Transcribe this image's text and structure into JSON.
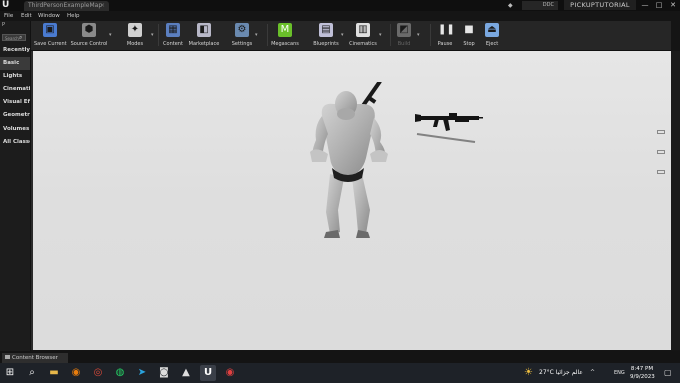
{
  "titlebar": {
    "logo": "U",
    "map_tab": "ThirdPersonExampleMap",
    "tab_close": "×",
    "ddc_label": "DDC",
    "project_name": "PICKUPTUTORIAL",
    "controls": [
      "—",
      "□",
      "✕"
    ]
  },
  "menu": [
    "File",
    "Edit",
    "Window",
    "Help"
  ],
  "modes_panel": {
    "mode_label": "P",
    "search_placeholder": "Search",
    "items": [
      {
        "label": "Recently",
        "selected": false
      },
      {
        "label": "Basic",
        "selected": true
      },
      {
        "label": "Lights",
        "selected": false
      },
      {
        "label": "Cinematic",
        "selected": false
      },
      {
        "label": "Visual Eff",
        "selected": false
      },
      {
        "label": "Geometry",
        "selected": false
      },
      {
        "label": "Volumes",
        "selected": false
      },
      {
        "label": "All Classe",
        "selected": false
      }
    ]
  },
  "toolbar": {
    "buttons": [
      {
        "label": "Save Current",
        "icon": "save-icon",
        "color": "#4a7bd0",
        "has_dropdown": false,
        "enabled": true
      },
      {
        "label": "Source Control",
        "icon": "source-control-icon",
        "color": "#8a8a8a",
        "has_dropdown": true,
        "enabled": true
      },
      {
        "label": "Modes",
        "icon": "modes-icon",
        "color": "#d0d0d0",
        "has_dropdown": true,
        "enabled": true
      },
      {
        "label": "Content",
        "icon": "content-icon",
        "color": "#5b7fc0",
        "has_dropdown": false,
        "enabled": true
      },
      {
        "label": "Marketplace",
        "icon": "marketplace-icon",
        "color": "#b8b8c8",
        "has_dropdown": false,
        "enabled": true
      },
      {
        "label": "Settings",
        "icon": "settings-icon",
        "color": "#6a8ab0",
        "has_dropdown": true,
        "enabled": true
      },
      {
        "label": "Megascans",
        "icon": "megascans-icon",
        "color": "#6ac02a",
        "has_dropdown": false,
        "enabled": true
      },
      {
        "label": "Blueprints",
        "icon": "blueprints-icon",
        "color": "#c0c0d8",
        "has_dropdown": true,
        "enabled": true
      },
      {
        "label": "Cinematics",
        "icon": "cinematics-icon",
        "color": "#e0e0e0",
        "has_dropdown": true,
        "enabled": true
      },
      {
        "label": "Build",
        "icon": "build-icon",
        "color": "#6a6a6a",
        "has_dropdown": true,
        "enabled": false
      },
      {
        "label": "Pause",
        "icon": "pause-icon",
        "color": "#e6e6e6",
        "has_dropdown": false,
        "enabled": true
      },
      {
        "label": "Stop",
        "icon": "stop-icon",
        "color": "#e6e6e6",
        "has_dropdown": false,
        "enabled": true
      },
      {
        "label": "Eject",
        "icon": "eject-icon",
        "color": "#7aa8e0",
        "has_dropdown": false,
        "enabled": true
      }
    ]
  },
  "viewport": {
    "character": "mannequin-with-rifle",
    "pickup": "rifle-pickup"
  },
  "content_browser": {
    "tab_label": "Content Browser"
  },
  "taskbar": {
    "apps": [
      {
        "name": "windows-start-icon",
        "glyph": "⊞",
        "color": "#ffffff"
      },
      {
        "name": "search-icon",
        "glyph": "⌕",
        "color": "#ffffff"
      },
      {
        "name": "file-explorer-icon",
        "glyph": "▬",
        "color": "#e8b84a"
      },
      {
        "name": "blender-icon",
        "glyph": "◉",
        "color": "#e87d0d"
      },
      {
        "name": "chrome-icon",
        "glyph": "◎",
        "color": "#e04b3a"
      },
      {
        "name": "whatsapp-icon",
        "glyph": "◍",
        "color": "#25d366"
      },
      {
        "name": "telegram-icon",
        "glyph": "➤",
        "color": "#2aa3de"
      },
      {
        "name": "obs-icon",
        "glyph": "◙",
        "color": "#dddddd"
      },
      {
        "name": "epic-launcher-icon",
        "glyph": "▲",
        "color": "#dddddd"
      },
      {
        "name": "unreal-engine-icon",
        "glyph": "U",
        "color": "#ffffff"
      },
      {
        "name": "recorder-icon",
        "glyph": "◉",
        "color": "#e04040"
      }
    ],
    "weather": {
      "temp": "27°C",
      "label": "عالم جزائيا"
    },
    "tray_chevron": "^",
    "language": "ENG",
    "time": "8:47 PM",
    "date": "9/9/2023"
  }
}
